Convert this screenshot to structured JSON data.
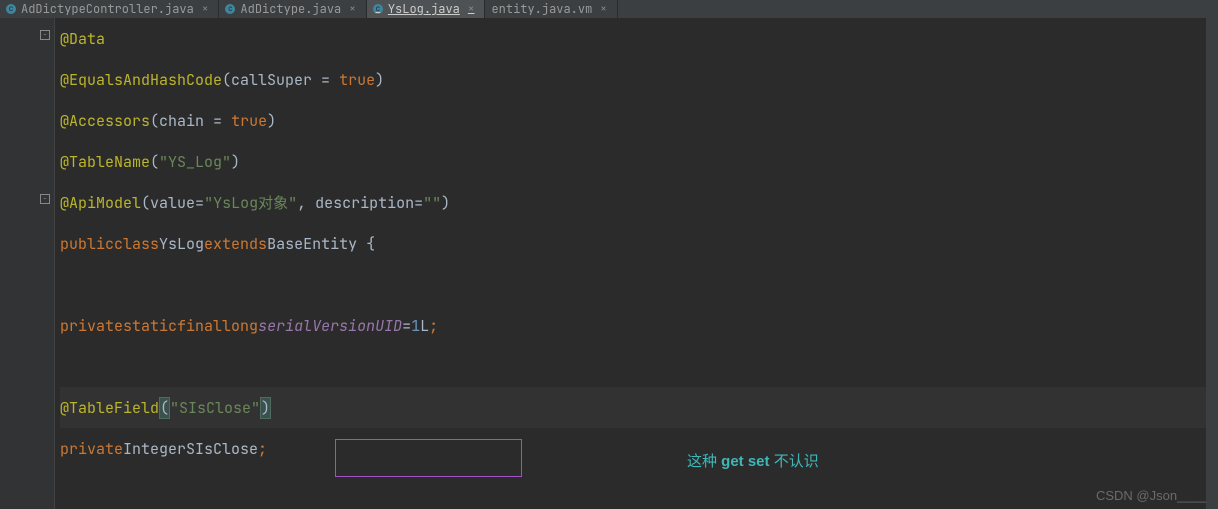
{
  "tabs": [
    {
      "label": "AdDictypeController.java"
    },
    {
      "label": "AdDictype.java"
    },
    {
      "label": "YsLog.java"
    },
    {
      "label": "entity.java.vm"
    }
  ],
  "code": {
    "l1_ann": "@Data",
    "l2_ann": "@EqualsAndHashCode",
    "l2_param": "callSuper",
    "l2_eq": " = ",
    "l2_val": "true",
    "l3_ann": "@Accessors",
    "l3_param": "chain",
    "l3_eq": " = ",
    "l3_val": "true",
    "l4_ann": "@TableName",
    "l4_str": "\"YS_Log\"",
    "l5_ann": "@ApiModel",
    "l5_p1": "value",
    "l5_eq1": "=",
    "l5_str1": "\"YsLog对象\"",
    "l5_comma": ", ",
    "l5_p2": "description",
    "l5_eq2": "=",
    "l5_str2": "\"\"",
    "l6_public": "public",
    "l6_class": "class",
    "l6_name": "YsLog",
    "l6_extends": "extends",
    "l6_base": "BaseEntity",
    "l6_brace": " {",
    "l7_private": "private",
    "l7_static": "static",
    "l7_final": "final",
    "l7_long": "long",
    "l7_field": "serialVersionUID",
    "l7_eq": "=",
    "l7_num": "1",
    "l7_L": "L",
    "l7_semi": ";",
    "l8_ann": "@TableField",
    "l8_str": "\"SIsClose\"",
    "l9_private": "private",
    "l9_type": "Integer",
    "l9_field": "SIsClose",
    "l9_semi": ";"
  },
  "annotation": {
    "prefix": "这种 ",
    "bold": "get set",
    "suffix": " 不认识"
  },
  "watermark": "CSDN @Json____"
}
